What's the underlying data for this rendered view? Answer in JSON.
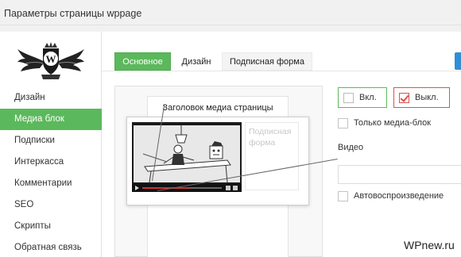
{
  "header": {
    "title": "Параметры страницы wppage"
  },
  "sidebar": {
    "items": [
      {
        "label": "Дизайн",
        "active": false
      },
      {
        "label": "Медиа блок",
        "active": true
      },
      {
        "label": "Подписки",
        "active": false
      },
      {
        "label": "Интеркасса",
        "active": false
      },
      {
        "label": "Комментарии",
        "active": false
      },
      {
        "label": "SEO",
        "active": false
      },
      {
        "label": "Скрипты",
        "active": false
      },
      {
        "label": "Обратная связь",
        "active": false
      }
    ]
  },
  "tabs": [
    {
      "label": "Основное",
      "active": true
    },
    {
      "label": "Дизайн",
      "active": false
    },
    {
      "label": "Подписная форма",
      "active": false
    }
  ],
  "preview": {
    "title": "Заголовок медиа страницы",
    "subscribe_placeholder_line1": "Подписная",
    "subscribe_placeholder_line2": "форма"
  },
  "settings": {
    "on_label": "Вкл.",
    "on_checked": false,
    "off_label": "Выкл.",
    "off_checked": true,
    "media_only_label": "Только медиа-блок",
    "media_only_checked": false,
    "video_label": "Видео",
    "video_value": "",
    "autoplay_label": "Автовоспроизведение",
    "autoplay_checked": false
  },
  "watermark": "WPnew.ru",
  "colors": {
    "accent_green": "#5cb85c",
    "off_red": "#d9534f",
    "blue_button": "#2f8fd6"
  }
}
